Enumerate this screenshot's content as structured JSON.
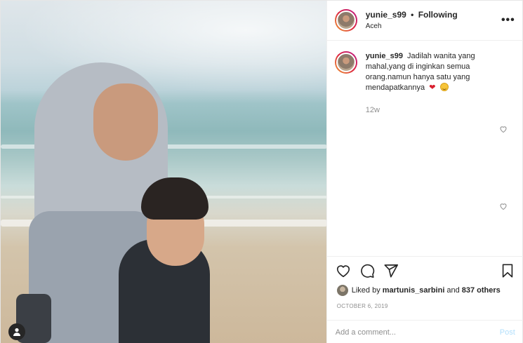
{
  "post": {
    "username": "yunie_s99",
    "separator": "•",
    "follow_status": "Following",
    "location": "Aceh",
    "more_label": "•••"
  },
  "caption": {
    "username": "yunie_s99",
    "text": "Jadilah wanita yang mahal,yang di inginkan semua orang.namun hanya satu yang mendapatkannya",
    "heart_emoji": "❤",
    "time": "12w"
  },
  "likes": {
    "prefix": "Liked by",
    "liker": "martunis_sarbini",
    "and": "and",
    "others": "837 others"
  },
  "date": "OCTOBER 6, 2019",
  "comment": {
    "placeholder": "Add a comment...",
    "post_label": "Post"
  },
  "icons": {
    "like": "heart-outline-icon",
    "comment": "comment-bubble-icon",
    "share": "paper-plane-icon",
    "save": "bookmark-icon",
    "tagged": "user-tag-icon"
  },
  "colors": {
    "accent_link": "#b2dffc",
    "muted_text": "#8e8e8e",
    "heart_red": "#d91f2e"
  }
}
